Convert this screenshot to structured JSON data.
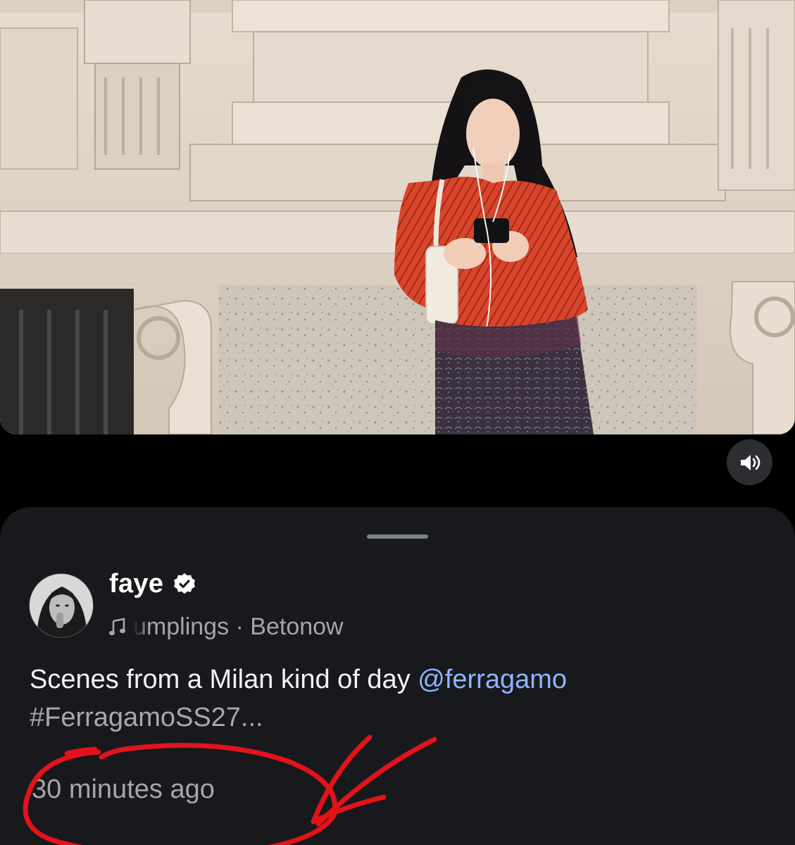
{
  "post": {
    "username": "faye",
    "verified_icon": "verified-badge-icon",
    "music": {
      "icon": "music-note-icon",
      "text": "umplings · Betonow"
    },
    "caption": {
      "text": "Scenes from a Milan kind of day ",
      "mention": "@ferragamo",
      "hashtag": "#FerragamoSS27..."
    },
    "timestamp": "30 minutes ago"
  },
  "media": {
    "mute_icon": "speaker-sound-icon"
  },
  "annotation": {
    "color": "#e3121b",
    "shapes": [
      "hand-drawn-circle",
      "hand-drawn-arrow"
    ]
  },
  "colors": {
    "sheet_background": "#17191c",
    "mention": "#8fb4ff",
    "secondary_text": "#a4a6aa"
  }
}
